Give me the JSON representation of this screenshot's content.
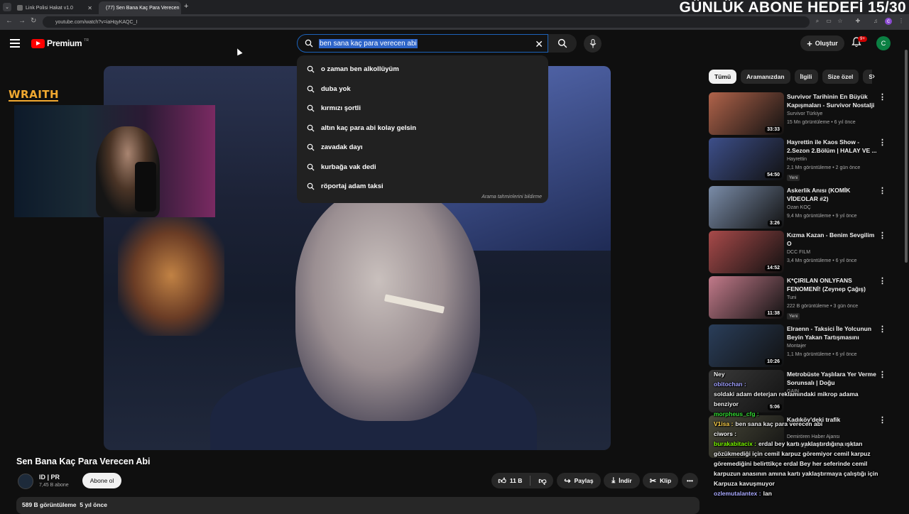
{
  "overlay": {
    "goal_title": "GÜNLÜK ABONE HEDEFİ 15/30"
  },
  "browser": {
    "tabs": [
      {
        "label": "Link Polisi Hakat v1.0",
        "active": false
      },
      {
        "label": "(77) Sen Bana Kaç Para Verecen",
        "active": true
      }
    ],
    "url": "youtube.com/watch?v=iaHqyKAQC_I"
  },
  "header": {
    "logo_text": "Premium",
    "logo_region": "TR",
    "search_value": "ben sana kaç para verecen abi",
    "create_label": "Oluştur",
    "notification_badge": "9+",
    "avatar_letter": "C"
  },
  "suggestions": {
    "items": [
      "o zaman ben alkollüyüm",
      "duba yok",
      "kırmızı şortli",
      "altın kaç para abi kolay gelsin",
      "zavadak dayı",
      "kurbağa vak dedi",
      "röportaj adam taksi"
    ],
    "footer": "Arama tahminlerini bildirme"
  },
  "stream": {
    "brand": "WRAITH"
  },
  "video": {
    "title": "Sen Bana Kaç Para Verecen Abi",
    "channel": "ID | PR",
    "subscribers": "7,45 B abone",
    "subscribe_label": "Abone ol",
    "likes": "11 B",
    "share_label": "Paylaş",
    "download_label": "İndir",
    "clip_label": "Klip",
    "views": "589 B görüntüleme",
    "age": "5 yıl önce"
  },
  "chips": [
    "Tümü",
    "Aramanızdan",
    "İlgili",
    "Size özel",
    "Son"
  ],
  "recommendations": [
    {
      "title": "Survivor Tarihinin En Büyük Kapışmaları - Survivor Nostalji",
      "channel": "Survivor Türkiye",
      "views": "15 Mn görüntüleme",
      "age": "6 yıl önce",
      "duration": "33:33",
      "badge": "",
      "thumb_color": "#b0634a"
    },
    {
      "title": "Hayrettin ile Kaos Show - 2.Sezon 2.Bölüm | HALAY VE ...",
      "channel": "Hayrettin",
      "views": "2,1 Mn görüntüleme",
      "age": "2 gün önce",
      "duration": "54:50",
      "badge": "Yeni",
      "thumb_color": "#3d4f8a"
    },
    {
      "title": "Askerlik Anısı (KOMİK VİDEOLAR #2)",
      "channel": "Ozan KOÇ",
      "views": "9,4 Mn görüntüleme",
      "age": "9 yıl önce",
      "duration": "3:26",
      "badge": "",
      "thumb_color": "#7a8ca8"
    },
    {
      "title": "Kızma Kazan - Benim Sevgilim O",
      "channel": "DCC FILM",
      "views": "3,4 Mn görüntüleme",
      "age": "6 yıl önce",
      "duration": "14:52",
      "badge": "",
      "thumb_color": "#a84a4a"
    },
    {
      "title": "K*ÇIRILAN ONLYFANS FENOMENİ! (Zeynep Çağış)",
      "channel": "Tuni",
      "views": "222 B görüntüleme",
      "age": "3 gün önce",
      "duration": "11:38",
      "badge": "Yeni",
      "thumb_color": "#c27a8a"
    },
    {
      "title": "Elraenn - Taksici İle Yolcunun Beyin Yakan Tartışmasını İzliyor",
      "channel": "Montajer",
      "views": "1,1 Mn görüntüleme",
      "age": "6 yıl önce",
      "duration": "10:26",
      "badge": "",
      "thumb_color": "#2a3e5a"
    },
    {
      "title": "Metrobüste Yaşlılara Yer Verme Sorunsalı | Doğu",
      "channel": "GAIN",
      "views": "",
      "age": "",
      "duration": "5:06",
      "badge": "",
      "thumb_color": "#3a3a3a"
    },
    {
      "title": "Kadıköy'deki trafik",
      "channel": "Demirören Haber Ajansı",
      "views": "1,5 Mn görüntüleme",
      "age": "2 yıl önce",
      "duration": "",
      "badge": "",
      "thumb_color": "#4a4a3a"
    }
  ],
  "chat": [
    {
      "user": "",
      "text": "Ney",
      "color": "#ffffff"
    },
    {
      "user": "obitochan :",
      "text": "",
      "color": "#a0a0ff"
    },
    {
      "user": "",
      "text": "soldaki adam deterjan reklamındaki mikrop adama",
      "color": "#ffffff"
    },
    {
      "user": "",
      "text": "benziyor",
      "color": "#ffffff"
    },
    {
      "user": "morpheus_cfg :",
      "text": "",
      "color": "#33dd33"
    },
    {
      "user": "V1isa :",
      "text": "ben sana kaç para verecen abi",
      "color": "#ffd24a"
    },
    {
      "user": "ciwors :",
      "text": "",
      "color": "#ffffff"
    },
    {
      "user": "burakabitacix :",
      "text": "erdal bey kartı yaklaştırdığına ışktan",
      "color": "#7cfc00"
    },
    {
      "user": "",
      "text": "gözükmediği için cemil karpuz göremiyor cemil karpuz",
      "color": "#ffffff"
    },
    {
      "user": "",
      "text": "göremediğini belirttikçe erdal Bey her seferinde cemil",
      "color": "#ffffff"
    },
    {
      "user": "",
      "text": "karpuzun anasının amına kartı yaklaştırmaya çalıştığı için",
      "color": "#ffffff"
    },
    {
      "user": "",
      "text": "Karpuza kavuşmuyor",
      "color": "#ffffff"
    },
    {
      "user": "ozlemutalantex :",
      "text": "lan",
      "color": "#aaaaff"
    }
  ],
  "colors": {
    "accent": "#ff0000",
    "background": "#0f0f0f",
    "chip_bg": "#272727"
  }
}
